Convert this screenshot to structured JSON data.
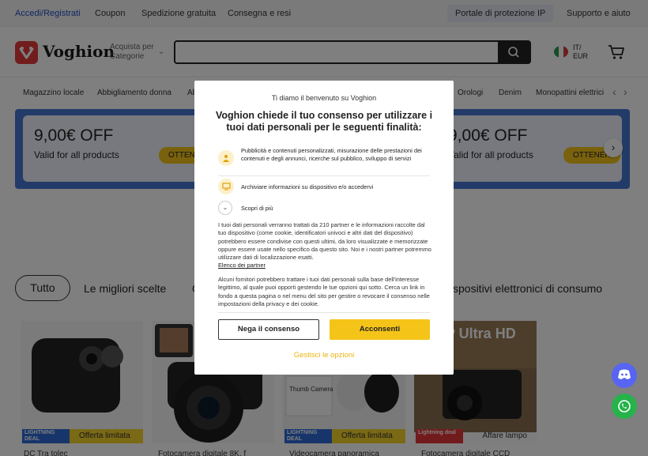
{
  "topbar": {
    "login": "Accedi/Registrati",
    "coupon": "Coupon",
    "shipping": "Spedizione gratuita",
    "delivery": "Consegna e resi",
    "ip_portal": "Portale di protezione IP",
    "support": "Supporto e aiuto"
  },
  "header": {
    "logo": "Voghion",
    "shop_by": "Acquista per Categorie",
    "search_placeholder": "",
    "lang_line1": "IT/",
    "lang_line2": "EUR"
  },
  "categories": [
    "Magazzino locale",
    "Abbigliamento donna",
    "Ab",
    "Orologi",
    "Denim",
    "Monopattini elettrici"
  ],
  "coupons": [
    {
      "amount": "9,00€ OFF",
      "validity": "Valid for all products",
      "button": "OTTENE"
    },
    {
      "amount": "9,00€ OFF",
      "validity": "Valid for all products",
      "button": "OTTENER"
    }
  ],
  "filters": {
    "all": "Tutto",
    "best": "Le migliori scelte",
    "partial_left": "C",
    "electronics": "spositivi elettronici di consumo"
  },
  "products": [
    {
      "deal": "LIGHTNING DEAL",
      "label": "Offerta limitata",
      "title": "DC Tra tolec"
    },
    {
      "deal": "",
      "label": "",
      "title": "Fotocamera digitale 8K, f"
    },
    {
      "deal": "LIGHTNING DEAL",
      "label": "Offerta limitata",
      "title": "Videocamera panoramica",
      "overlay_text": "Thumb Camera"
    },
    {
      "deal": "Lightning deal",
      "label": "Affare lampo",
      "title": "Fotocamera digitale CCD",
      "overlay_text": "P Ultra HD"
    }
  ],
  "modal": {
    "welcome": "Ti diamo il benvenuto su Voghion",
    "title": "Voghion chiede il tuo consenso per utilizzare i tuoi dati personali per le seguenti finalità:",
    "purpose1": "Pubblicità e contenuti personalizzati, misurazione delle prestazioni dei contenuti e degli annunci, ricerche sul pubblico, sviluppo di servizi",
    "purpose2": "Archiviare informazioni su dispositivo e/o accedervi",
    "learn_more": "Scopri di più",
    "body1": "I tuoi dati personali verranno trattati da 210 partner e le informazioni raccolte dal tuo dispositivo (come cookie, identificatori univoci e altri dati del dispositivo) potrebbero essere condivise con questi ultimi, da loro visualizzate e memorizzate oppure essere usate nello specifico da questo sito. Noi e i nostri partner potremmo utilizzare dati di localizzazione esatti.",
    "partners_link": "Elenco dei partner",
    "body2": "Alcuni fornitori potrebbero trattare i tuoi dati personali sulla base dell'interesse legittimo, al quale puoi opporti gestendo le tue opzioni qui sotto. Cerca un link in fondo a questa pagina o nel menu del sito per gestire o revocare il consenso nelle impostazioni della privacy e dei cookie.",
    "deny": "Nega il consenso",
    "accept": "Acconsenti",
    "manage": "Gestisci le opzioni"
  },
  "colors": {
    "brand_red": "#e43b3b",
    "accent_yellow": "#f5c419",
    "banner_blue": "#4777d3",
    "link_blue": "#1d4fc4"
  }
}
